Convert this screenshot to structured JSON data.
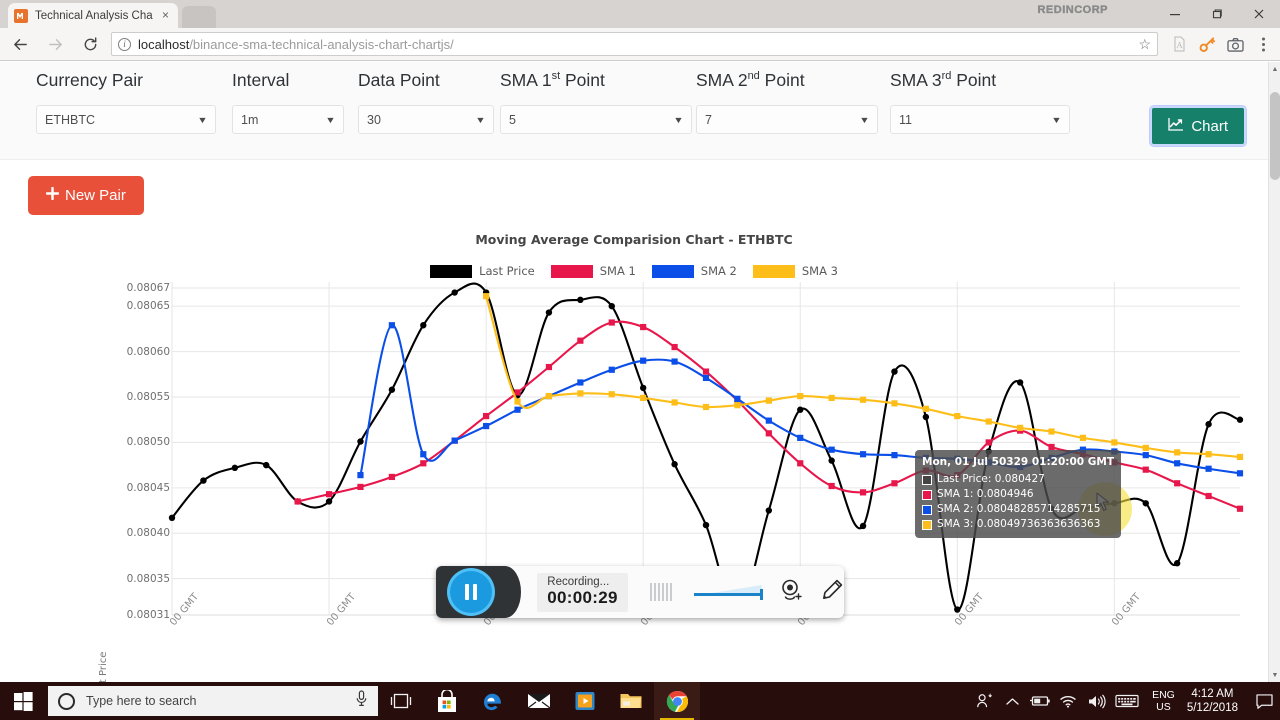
{
  "browser": {
    "tab_title": "Technical Analysis Chart",
    "favicon_glyph": "M",
    "close_glyph": "×",
    "url_host": "localhost",
    "url_path": "/binance-sma-technical-analysis-chart-chartjs/",
    "window_brand": "REDINCORP",
    "controls": {
      "minimize": "—",
      "maximize": "❐",
      "close": "✕"
    },
    "extensions": [
      "pdf-icon",
      "key-icon",
      "camera-icon",
      "kebab-menu-icon"
    ]
  },
  "form": {
    "fields": [
      {
        "label": "Currency Pair",
        "label_sup": "",
        "value": "ETHBTC"
      },
      {
        "label": "Interval",
        "label_sup": "",
        "value": "1m"
      },
      {
        "label": "Data Point",
        "label_sup": "",
        "value": "30"
      },
      {
        "label": "SMA 1",
        "label_sup": "st",
        "label_tail": " Point",
        "value": "5"
      },
      {
        "label": "SMA 2",
        "label_sup": "nd",
        "label_tail": " Point",
        "value": "7"
      },
      {
        "label": "SMA 3",
        "label_sup": "rd",
        "label_tail": " Point",
        "value": "11"
      }
    ],
    "chart_button": "Chart",
    "chart_button_icon": "line-chart-icon",
    "new_pair_button": "New Pair",
    "new_pair_icon": "plus-icon",
    "caret_glyph": "▼",
    "colors": {
      "chart_btn": "#17806b",
      "new_pair_btn": "#e8503a"
    }
  },
  "chart_data": {
    "type": "line",
    "title": "Moving Average Comparision Chart - ETHBTC",
    "xlabel": "",
    "ylabel": "Last Price",
    "ylim": [
      0.08031,
      0.08067
    ],
    "yticks": [
      "0.08067",
      "0.08065",
      "0.08060",
      "0.08055",
      "0.08050",
      "0.08045",
      "0.08040",
      "0.08035",
      "0.08031"
    ],
    "ytick_values": [
      0.08067,
      0.08065,
      0.0806,
      0.08055,
      0.0805,
      0.08045,
      0.0804,
      0.08035,
      0.08031
    ],
    "grid": true,
    "legend_position": "top",
    "xticks": [
      "00 GMT",
      "00 GMT",
      "00 GMT",
      "00 GMT",
      "00 GMT",
      "00 GMT",
      "00 GMT"
    ],
    "series": [
      {
        "name": "Last Price",
        "color": "#000000",
        "values": [
          0.080417,
          0.080458,
          0.080472,
          0.080475,
          0.080435,
          0.080435,
          0.080501,
          0.080558,
          0.080629,
          0.080665,
          0.080665,
          0.080552,
          0.080643,
          0.080657,
          0.08065,
          0.08056,
          0.080476,
          0.080409,
          0.080313,
          0.080425,
          0.080536,
          0.08048,
          0.080408,
          0.080578,
          0.080528,
          0.080316,
          0.08049,
          0.080566,
          0.080427,
          0.080427,
          0.080433,
          0.080433,
          0.080367,
          0.08052,
          0.080525
        ]
      },
      {
        "name": "SMA 1",
        "color": "#e8174b",
        "values": [
          null,
          null,
          null,
          null,
          0.080435,
          0.080443,
          0.080451,
          0.080462,
          0.080477,
          0.080502,
          0.080529,
          0.080555,
          0.080583,
          0.080612,
          0.080632,
          0.080627,
          0.080605,
          0.080578,
          0.080546,
          0.08051,
          0.080477,
          0.080452,
          0.080445,
          0.080455,
          0.080469,
          0.080464,
          0.0805,
          0.080513,
          0.080495,
          0.080487,
          0.080478,
          0.08047,
          0.080455,
          0.080441,
          0.080427
        ]
      },
      {
        "name": "SMA 2",
        "color": "#0b4fe8",
        "values": [
          null,
          null,
          null,
          null,
          null,
          null,
          0.080464,
          0.080629,
          0.080487,
          0.080502,
          0.080518,
          0.080536,
          0.080551,
          0.080566,
          0.08058,
          0.08059,
          0.080589,
          0.080571,
          0.080548,
          0.080524,
          0.080505,
          0.080492,
          0.080487,
          0.080486,
          0.080483,
          0.080482,
          0.080478,
          0.080473,
          0.080483,
          0.080492,
          0.08049,
          0.080486,
          0.080477,
          0.080471,
          0.080466
        ]
      },
      {
        "name": "SMA 3",
        "color": "#fdbe19",
        "values": [
          null,
          null,
          null,
          null,
          null,
          null,
          null,
          null,
          null,
          null,
          0.080661,
          0.080545,
          0.080551,
          0.080554,
          0.080553,
          0.080549,
          0.080544,
          0.080539,
          0.080541,
          0.080546,
          0.080551,
          0.080549,
          0.080547,
          0.080543,
          0.080537,
          0.080529,
          0.080523,
          0.080516,
          0.080512,
          0.080505,
          0.0805,
          0.080494,
          0.080489,
          0.080487,
          0.080484
        ]
      }
    ]
  },
  "tooltip": {
    "title": "Mon, 01 Jul 50329 01:20:00 GMT",
    "rows": [
      {
        "label": "Last Price: 0.080427",
        "color": "#444444"
      },
      {
        "label": "SMA 1: 0.0804946",
        "color": "#e8174b"
      },
      {
        "label": "SMA 2: 0.08048285714285715",
        "color": "#0b4fe8"
      },
      {
        "label": "SMA 3: 0.08049736363636363",
        "color": "#fdbe19"
      }
    ]
  },
  "recorder": {
    "status": "Recording...",
    "time": "00:00:29",
    "pause_icon": "pause-icon",
    "webcam_icon": "webcam-add-icon",
    "pencil_icon": "pencil-icon",
    "meter_icon": "audio-meter-icon"
  },
  "taskbar": {
    "search_placeholder": "Type here to search",
    "start_icon": "windows-start-icon",
    "cortana_icon": "cortana-circle-icon",
    "mic_icon": "microphone-icon",
    "apps": [
      "task-view-icon",
      "microsoft-store-icon",
      "edge-icon",
      "mail-icon",
      "movies-tv-icon",
      "file-explorer-icon",
      "chrome-icon"
    ],
    "tray": [
      "people-icon",
      "show-hidden-icons-icon",
      "battery-icon",
      "wifi-icon",
      "volume-icon",
      "keyboard-icon"
    ],
    "language": "ENG",
    "region": "US",
    "time": "4:12 AM",
    "date": "5/12/2018",
    "notification_icon": "action-center-icon"
  }
}
